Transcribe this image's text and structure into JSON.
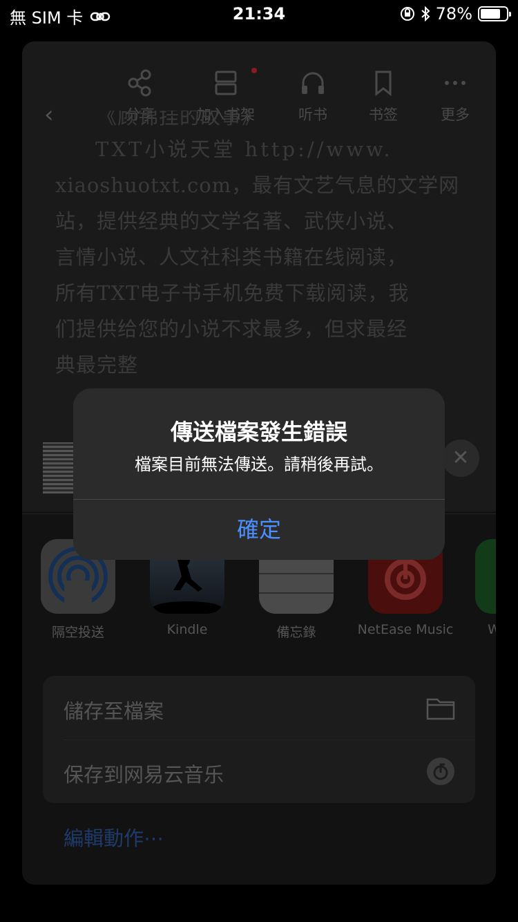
{
  "status_bar": {
    "carrier": "無 SIM 卡",
    "time": "21:34",
    "battery": "78%",
    "battery_level": 0.78
  },
  "reader": {
    "toolbar": [
      {
        "label": "分享",
        "icon": "share-icon"
      },
      {
        "label": "加入书架",
        "icon": "bookshelf-add-icon"
      },
      {
        "label": "听书",
        "icon": "headphones-icon"
      },
      {
        "label": "书签",
        "icon": "bookmark-icon"
      },
      {
        "label": "更多",
        "icon": "more-icon"
      }
    ],
    "text_lines": [
      "《顾锦挂的故事》",
      "TXT小说天堂 http://www.",
      "xiaoshuotxt.com，最有文艺气息的文学网",
      "站，提供经典的文学名著、武侠小说、",
      "言情小说、人文社科类书籍在线阅读，",
      "所有TXT电子书手机免费下载阅读，我",
      "们提供给您的小说不求最多，但求最经",
      "典最完整"
    ]
  },
  "share_sheet": {
    "apps": [
      {
        "label": "隔空投送",
        "icon": "airdrop-icon"
      },
      {
        "label": "Kindle",
        "icon": "kindle-icon"
      },
      {
        "label": "備忘錄",
        "icon": "notes-icon"
      },
      {
        "label": "NetEase Music",
        "icon": "netease-music-icon"
      },
      {
        "label": "W",
        "icon": "wechat-icon"
      }
    ],
    "actions": [
      {
        "label": "儲存至檔案",
        "icon": "folder-icon"
      },
      {
        "label": "保存到网易云音乐",
        "icon": "netease-music-icon"
      }
    ],
    "edit_actions": "編輯動作⋯",
    "bottom_items": [
      "..."
    ]
  },
  "alert": {
    "title": "傳送檔案發生錯誤",
    "message": "檔案目前無法傳送。請稍後再試。",
    "button": "確定"
  },
  "colors": {
    "alert_button": "#4a90ff",
    "netease_red": "#c0211c",
    "airdrop_blue": "#1e7cf5"
  }
}
